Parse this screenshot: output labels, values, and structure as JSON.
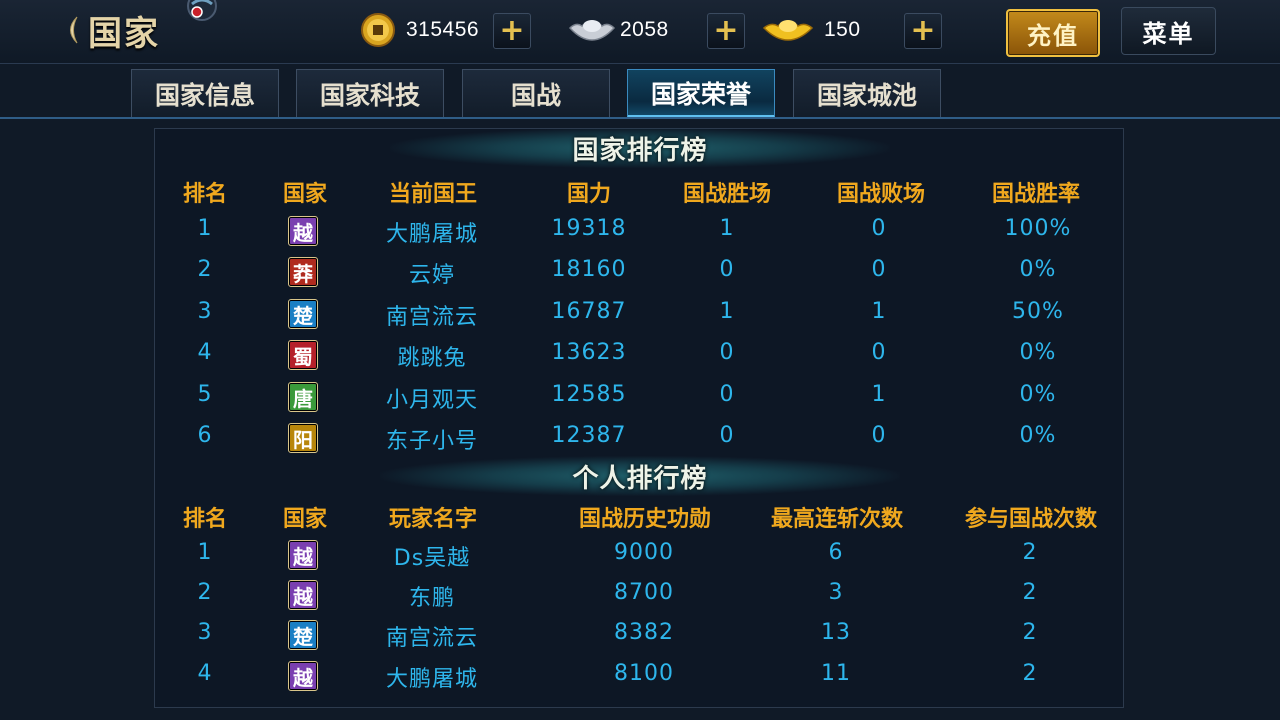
{
  "header": {
    "title": "国家",
    "copper": "315456",
    "silver": "2058",
    "gold": "150",
    "recharge_label": "充值",
    "menu_label": "菜单"
  },
  "tabs": [
    {
      "label": "国家信息",
      "active": false
    },
    {
      "label": "国家科技",
      "active": false
    },
    {
      "label": "国战",
      "active": false
    },
    {
      "label": "国家荣誉",
      "active": true
    },
    {
      "label": "国家城池",
      "active": false
    }
  ],
  "colors": {
    "header_text": "#f0a81e",
    "cell_text": "#2eb6ec",
    "yue": "#7a3fb0",
    "mang": "#b02a1e",
    "chu": "#1a7fc4",
    "shu": "#b5202a",
    "tang": "#3a9a3a",
    "yang": "#b8860b"
  },
  "nation_ranking": {
    "title": "国家排行榜",
    "headers": [
      "排名",
      "国家",
      "当前国王",
      "国力",
      "国战胜场",
      "国战败场",
      "国战胜率"
    ],
    "rows": [
      {
        "rank": "1",
        "nation": "越",
        "color": "#7a3fb0",
        "king": "大鹏屠城",
        "power": "19318",
        "wins": "1",
        "losses": "0",
        "rate": "100%"
      },
      {
        "rank": "2",
        "nation": "莽",
        "color": "#b02a1e",
        "king": "云婷",
        "power": "18160",
        "wins": "0",
        "losses": "0",
        "rate": "0%"
      },
      {
        "rank": "3",
        "nation": "楚",
        "color": "#1a7fc4",
        "king": "南宫流云",
        "power": "16787",
        "wins": "1",
        "losses": "1",
        "rate": "50%"
      },
      {
        "rank": "4",
        "nation": "蜀",
        "color": "#b5202a",
        "king": "跳跳兔",
        "power": "13623",
        "wins": "0",
        "losses": "0",
        "rate": "0%"
      },
      {
        "rank": "5",
        "nation": "唐",
        "color": "#3a9a3a",
        "king": "小月观天",
        "power": "12585",
        "wins": "0",
        "losses": "1",
        "rate": "0%"
      },
      {
        "rank": "6",
        "nation": "阳",
        "color": "#b8860b",
        "king": "东子小号",
        "power": "12387",
        "wins": "0",
        "losses": "0",
        "rate": "0%"
      }
    ]
  },
  "personal_ranking": {
    "title": "个人排行榜",
    "headers": [
      "排名",
      "国家",
      "玩家名字",
      "国战历史功勋",
      "最高连斩次数",
      "参与国战次数"
    ],
    "rows": [
      {
        "rank": "1",
        "nation": "越",
        "color": "#7a3fb0",
        "name": "Ds吴越",
        "merit": "9000",
        "streak": "6",
        "joins": "2"
      },
      {
        "rank": "2",
        "nation": "越",
        "color": "#7a3fb0",
        "name": "东鹏",
        "merit": "8700",
        "streak": "3",
        "joins": "2"
      },
      {
        "rank": "3",
        "nation": "楚",
        "color": "#1a7fc4",
        "name": "南宫流云",
        "merit": "8382",
        "streak": "13",
        "joins": "2"
      },
      {
        "rank": "4",
        "nation": "越",
        "color": "#7a3fb0",
        "name": "大鹏屠城",
        "merit": "8100",
        "streak": "11",
        "joins": "2"
      }
    ]
  }
}
